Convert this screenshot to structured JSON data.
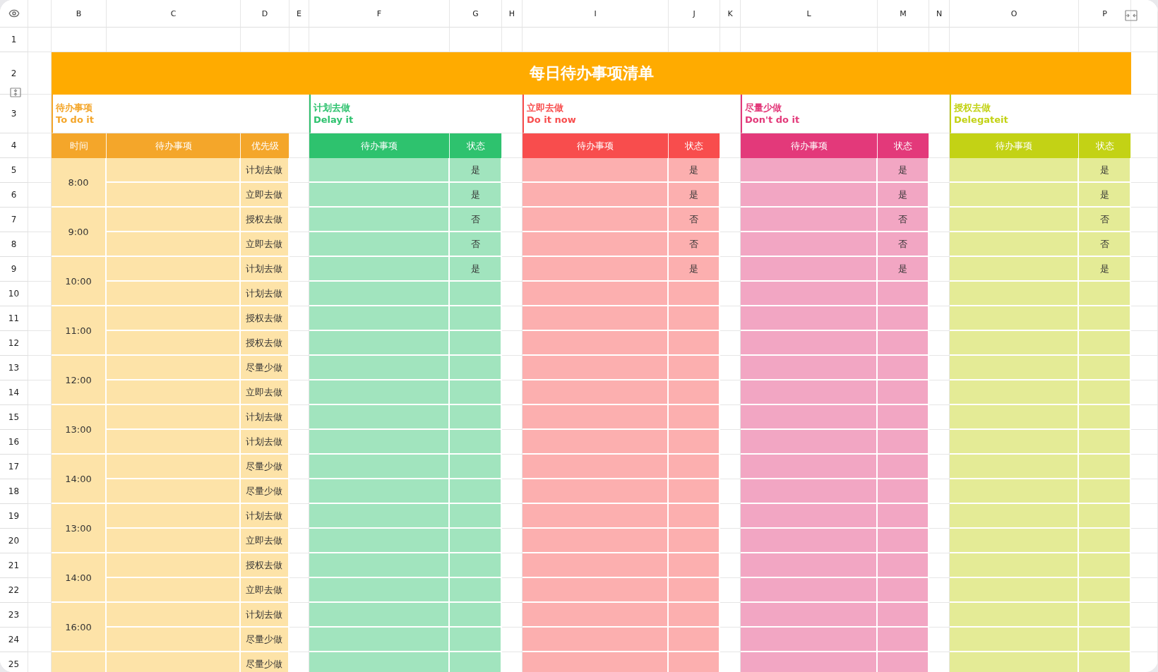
{
  "column_headers": [
    "B",
    "C",
    "D",
    "E",
    "F",
    "G",
    "H",
    "I",
    "J",
    "K",
    "L",
    "M",
    "N",
    "O",
    "P"
  ],
  "row_numbers": [
    "1",
    "2",
    "3",
    "4",
    "5",
    "6",
    "7",
    "8",
    "9",
    "10",
    "11",
    "12",
    "13",
    "14",
    "15",
    "16",
    "17",
    "18",
    "19",
    "20",
    "21",
    "22",
    "23",
    "24",
    "25"
  ],
  "title": "每日待办事项清单",
  "todo": {
    "title": "待办事项",
    "subtitle": "To do it",
    "headers": [
      "时间",
      "待办事项",
      "优先级"
    ],
    "slots": [
      {
        "time": "8:00",
        "priorities": [
          "计划去做",
          "立即去做"
        ]
      },
      {
        "time": "9:00",
        "priorities": [
          "授权去做",
          "立即去做"
        ]
      },
      {
        "time": "10:00",
        "priorities": [
          "计划去做",
          "计划去做"
        ]
      },
      {
        "time": "11:00",
        "priorities": [
          "授权去做",
          "授权去做"
        ]
      },
      {
        "time": "12:00",
        "priorities": [
          "尽量少做",
          "立即去做"
        ]
      },
      {
        "time": "13:00",
        "priorities": [
          "计划去做",
          "计划去做"
        ]
      },
      {
        "time": "14:00",
        "priorities": [
          "尽量少做",
          "尽量少做"
        ]
      },
      {
        "time": "13:00",
        "priorities": [
          "计划去做",
          "立即去做"
        ]
      },
      {
        "time": "14:00",
        "priorities": [
          "授权去做",
          "立即去做"
        ]
      },
      {
        "time": "16:00",
        "priorities": [
          "计划去做",
          "尽量少做"
        ]
      },
      {
        "priorities": [
          "尽量少做"
        ]
      }
    ]
  },
  "quadrants": [
    {
      "title": "计划去做",
      "subtitle": "Delay it",
      "color": "#2ec26e",
      "headers": [
        "待办事项",
        "状态"
      ],
      "statuses": [
        "是",
        "是",
        "否",
        "否",
        "是"
      ]
    },
    {
      "title": "立即去做",
      "subtitle": "Do it now",
      "color": "#f84d4d",
      "headers": [
        "待办事项",
        "状态"
      ],
      "statuses": [
        "是",
        "是",
        "否",
        "否",
        "是"
      ]
    },
    {
      "title": "尽量少做",
      "subtitle": "Don't do it",
      "color": "#e3397a",
      "headers": [
        "待办事项",
        "状态"
      ],
      "statuses": [
        "是",
        "是",
        "否",
        "否",
        "是"
      ]
    },
    {
      "title": "授权去做",
      "subtitle": "Delegateit",
      "color": "#c3d215",
      "headers": [
        "待办事项",
        "状态"
      ],
      "statuses": [
        "是",
        "是",
        "否",
        "否",
        "是"
      ]
    }
  ]
}
